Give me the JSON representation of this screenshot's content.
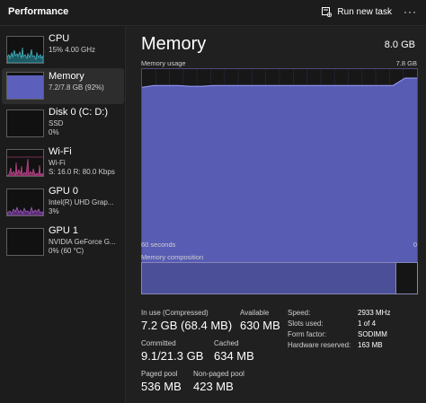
{
  "app": {
    "title": "Performance",
    "run_task_label": "Run new task",
    "more_label": "···"
  },
  "colors": {
    "accent": "#4b4f98",
    "memory_fill": "#5c60bc",
    "cpu": "#45b5c4",
    "wifi": "#d94fa0",
    "gpu": "#b56bd6"
  },
  "sidebar": {
    "items": [
      {
        "name": "CPU",
        "sub1": "15% 4.00 GHz",
        "sub2": "",
        "sub3": ""
      },
      {
        "name": "Memory",
        "sub1": "7.2/7.8 GB (92%)",
        "sub2": "",
        "sub3": ""
      },
      {
        "name": "Disk 0 (C: D:)",
        "sub1": "SSD",
        "sub2": "0%",
        "sub3": ""
      },
      {
        "name": "Wi-Fi",
        "sub1": "Wi-Fi",
        "sub2": "S: 16.0 R: 80.0 Kbps",
        "sub3": ""
      },
      {
        "name": "GPU 0",
        "sub1": "Intel(R) UHD Grap...",
        "sub2": "3%",
        "sub3": ""
      },
      {
        "name": "GPU 1",
        "sub1": "NVIDIA GeForce G...",
        "sub2": "0% (60 °C)",
        "sub3": ""
      }
    ]
  },
  "main": {
    "heading": "Memory",
    "total": "8.0 GB",
    "usage_label": "Memory usage",
    "usage_max": "7.8 GB",
    "time_left": "60 seconds",
    "time_right": "0",
    "composition_label": "Memory composition",
    "composition": {
      "in_use_fraction": 0.92
    },
    "usage_history_fraction": [
      0.909,
      0.918,
      0.918,
      0.918,
      0.914,
      0.914,
      0.918,
      0.918,
      0.918,
      0.918,
      0.918,
      0.918,
      0.918,
      0.918,
      0.918,
      0.918,
      0.918,
      0.918,
      0.918,
      0.918,
      0.918,
      0.918,
      0.955,
      0.955
    ],
    "stats": {
      "in_use_label": "In use (Compressed)",
      "in_use_value": "7.2 GB (68.4 MB)",
      "available_label": "Available",
      "available_value": "630 MB",
      "committed_label": "Committed",
      "committed_value": "9.1/21.3 GB",
      "cached_label": "Cached",
      "cached_value": "634 MB",
      "paged_label": "Paged pool",
      "paged_value": "536 MB",
      "nonpaged_label": "Non-paged pool",
      "nonpaged_value": "423 MB"
    },
    "details": [
      {
        "key": "Speed:",
        "value": "2933 MHz"
      },
      {
        "key": "Slots used:",
        "value": "1 of 4"
      },
      {
        "key": "Form factor:",
        "value": "SODIMM"
      },
      {
        "key": "Hardware reserved:",
        "value": "163 MB"
      }
    ]
  }
}
